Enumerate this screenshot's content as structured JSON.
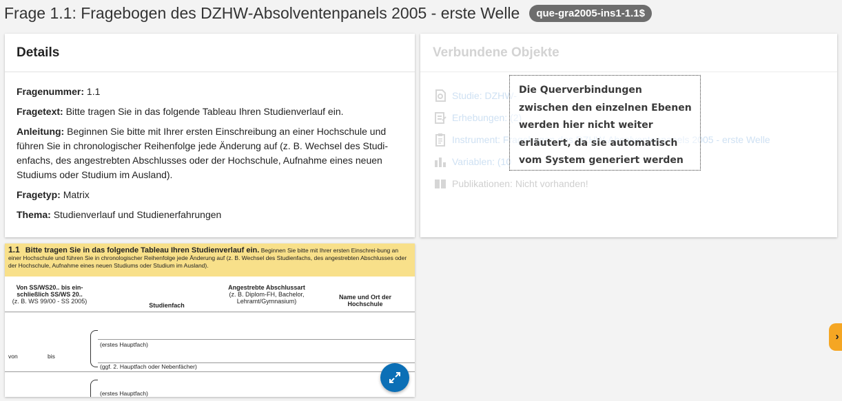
{
  "header": {
    "title": "Frage 1.1: Fragebogen des DZHW-Absolventenpanels 2005 - erste Welle",
    "question_id": "que-gra2005-ins1-1.1$"
  },
  "details": {
    "heading": "Details",
    "fragenummer_label": "Fragenummer:",
    "fragenummer_value": "1.1",
    "fragetext_label": "Fragetext:",
    "fragetext_value": "Bitte tragen Sie in das folgende Tableau Ihren Studienverlauf ein.",
    "anleitung_label": "Anleitung:",
    "anleitung_value": "Beginnen Sie bitte mit Ihrer ersten Einschreibung an einer Hochschule und führen Sie in chronologischer Reihenfolge jede Änderung auf (z. B. Wechsel des Studi-enfachs, des angestrebten Abschlusses oder der Hochschule, Aufnahme eines neuen Studiums oder Studium im Ausland).",
    "fragetyp_label": "Fragetyp:",
    "fragetyp_value": "Matrix",
    "thema_label": "Thema:",
    "thema_value": "Studienverlauf und Studienerfahrungen"
  },
  "linked": {
    "heading": "Verbundene Objekte",
    "items": [
      {
        "label": "Studie: DZHW-",
        "icon": "study-icon"
      },
      {
        "label": "Erhebungen: (2)",
        "icon": "survey-icon"
      },
      {
        "label": "Instrument: Fragebogen des DZHW-Absolventenpanels 2005 - erste Welle",
        "icon": "clipboard-icon"
      },
      {
        "label": "Variablen: (10",
        "icon": "bar-chart-icon"
      },
      {
        "label": "Publikationen: Nicht vorhanden!",
        "icon": "book-icon"
      }
    ]
  },
  "tooltip": {
    "lines": [
      "Die Querverbindungen",
      "zwischen den einzelnen Ebenen",
      "werden hier nicht weiter",
      "erläutert, da sie automatisch",
      "vom System generiert werden"
    ]
  },
  "preview": {
    "qnum": "1.1",
    "qtext_bold": "Bitte tragen Sie in das folgende Tableau Ihren Studienverlauf ein.",
    "qtext_rest": "Beginnen Sie bitte mit Ihrer ersten Einschrei-bung an einer Hochschule und führen Sie in chronologischer Reihenfolge jede Änderung auf (z. B. Wechsel des Studienfachs, des angestrebten Abschlusses oder der Hochschule, Aufnahme eines neuen Studiums oder Studium im Ausland).",
    "col1_bold": "Von SS/WS20.. bis ein-schließlich SS/WS 20..",
    "col1_sub": "(z. B. WS 99/00 - SS 2005)",
    "col2": "Studienfach",
    "col3_bold": "Angestrebte Abschlussart",
    "col3_sub": "(z. B. Diplom-FH, Bachelor, Lehramt/Gymnasium)",
    "col4": "Name und Ort der Hochschule",
    "row_von": "von",
    "row_bis": "bis",
    "first_major": "(erstes Hauptfach)",
    "second_major": "(ggf. 2. Hauptfach oder Nebenfächer)",
    "first_major_2": "(erstes Hauptfach)"
  },
  "colors": {
    "badge": "#6d6d6d",
    "banner": "#f8e08a",
    "expand": "#0b6fb6",
    "side_tab": "#f5a623"
  }
}
